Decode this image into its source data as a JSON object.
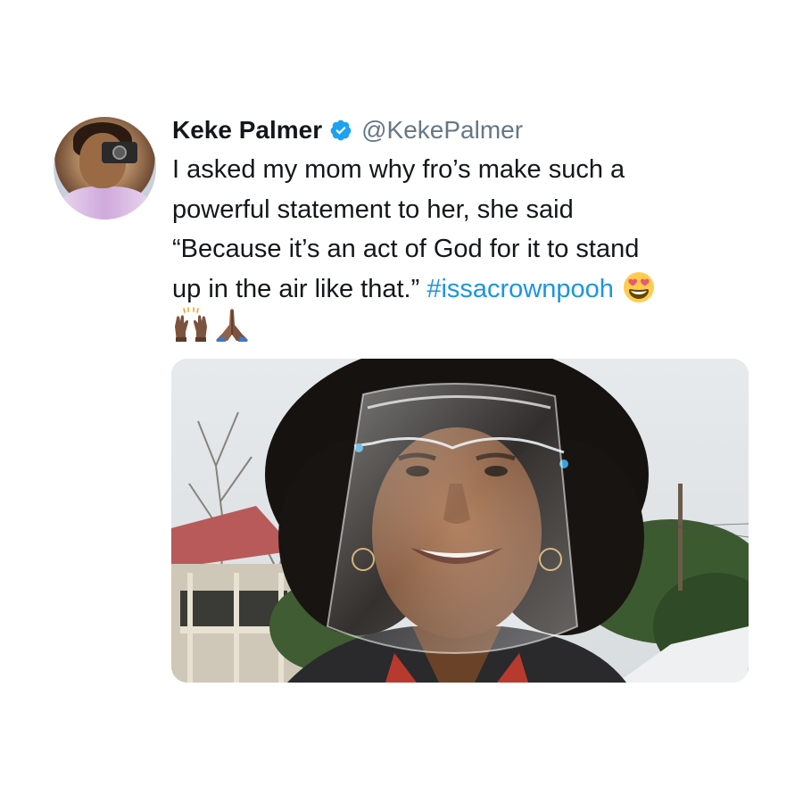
{
  "tweet": {
    "author": {
      "display_name": "Keke Palmer",
      "handle": "@KekePalmer",
      "verified": true
    },
    "text_lines": [
      "I asked my mom why fro’s make such a",
      "powerful statement to her, she said",
      "“Because it’s an act of God for it to stand"
    ],
    "last_line_text": "up in the air like that.”",
    "hashtag": "#issacrownpooh",
    "emojis": [
      "smiling-face-with-heart-eyes",
      "raising-hands-dark-skin-tone",
      "folded-hands-dark-skin-tone"
    ]
  },
  "colors": {
    "hashtag": "#1b95e0",
    "handle": "#657786",
    "verified": "#1da1f2",
    "text": "#14171a"
  }
}
